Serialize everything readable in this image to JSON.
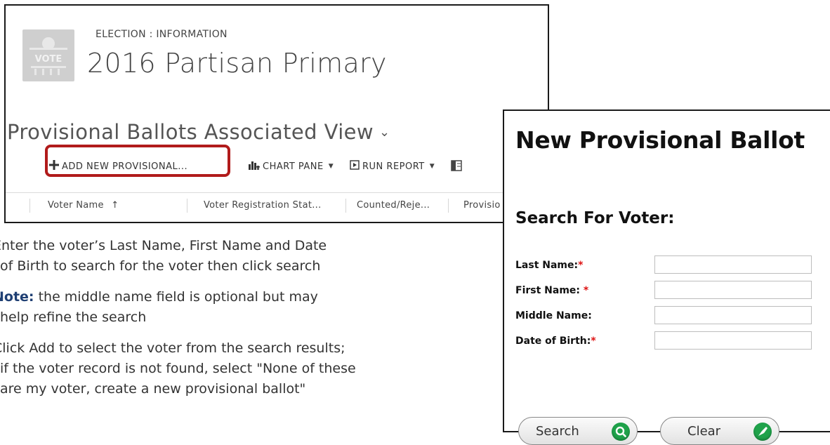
{
  "crm": {
    "entity_label": "ELECTION : INFORMATION",
    "record_title": "2016 Partisan Primary",
    "logo_text": "VOTE",
    "view_title": "Provisional Ballots Associated View",
    "view_chevron": "⌄",
    "commands": [
      {
        "label": "ADD NEW PROVISIONAL...",
        "icon": "plus-icon",
        "has_dropdown": false
      },
      {
        "label": "CHART PANE",
        "icon": "chart-icon",
        "has_dropdown": true
      },
      {
        "label": "RUN REPORT",
        "icon": "report-icon",
        "has_dropdown": true
      },
      {
        "label": "",
        "icon": "excel-icon",
        "has_dropdown": false
      }
    ],
    "highlight_color": "#b11b1b",
    "columns": [
      "Voter Name",
      "Voter Registration Stat...",
      "Counted/Reje...",
      "Provisio"
    ],
    "sort_indicator": "↑"
  },
  "instructions": {
    "paragraph1_line1": "Enter the voter’s Last Name, First Name and Date",
    "paragraph1_line2": "of Birth to search for the voter then click search",
    "note_label": "Note:",
    "paragraph2_line1_rest": " the middle name field is optional but may",
    "paragraph2_line2": "help refine the search",
    "paragraph3_line1": "Click Add to select the voter from the search results;",
    "paragraph3_line2": "if the voter record is not found, select  \"None of these",
    "paragraph3_line3": "are my voter, create a new provisional ballot\""
  },
  "ballot_form": {
    "title": "New Provisional Ballot",
    "search_heading": "Search For Voter:",
    "fields": [
      {
        "label": "Last Name:",
        "required": true,
        "value": ""
      },
      {
        "label": "First Name: ",
        "required": true,
        "value": ""
      },
      {
        "label": "Middle Name:",
        "required": false,
        "value": ""
      },
      {
        "label": "Date of Birth:",
        "required": true,
        "value": ""
      }
    ],
    "required_marker": "*",
    "search_button": "Search",
    "clear_button": "Clear",
    "button_icon_color": "#1fa24a"
  }
}
